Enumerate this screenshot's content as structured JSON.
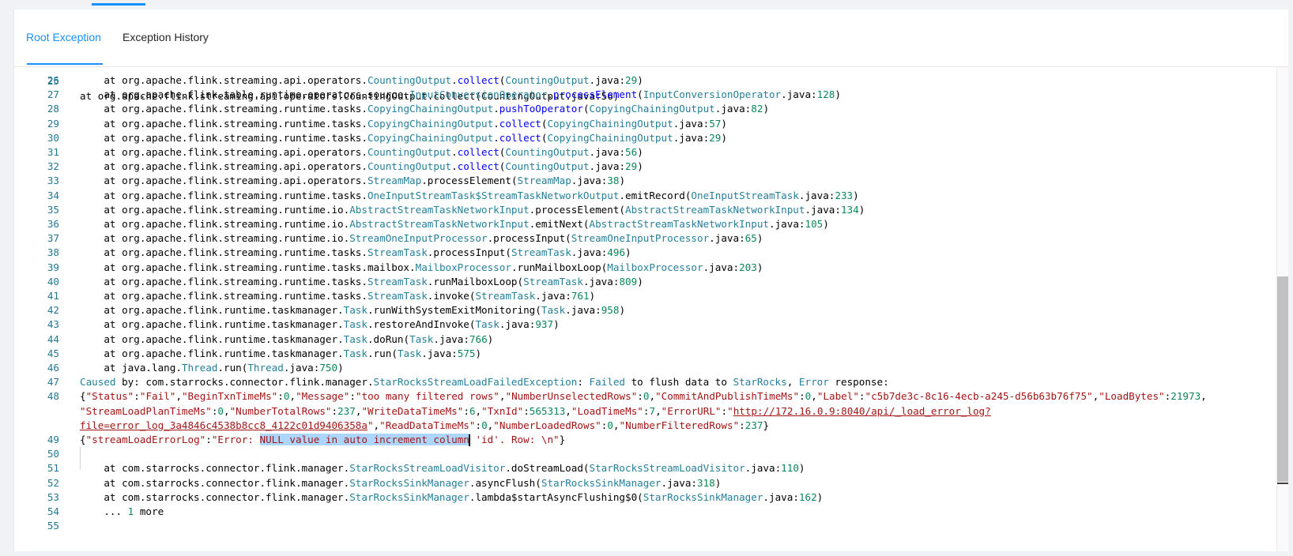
{
  "tabs": {
    "root_exception": "Root Exception",
    "exception_history": "Exception History"
  },
  "colors": {
    "accent": "#1890ff",
    "line_number": "#237893",
    "class_name": "#267f99",
    "method": "#0000ff",
    "number": "#098658",
    "string": "#a31515",
    "selection": "#add6ff"
  },
  "code": {
    "partial_top_line": "at org.apache.flink.streaming.api.operators.CountingOutput.collect(CountingOutput.java:56)",
    "lines": [
      {
        "n": "26",
        "pre": "    at org.apache.flink.streaming.api.operators.",
        "cls": "CountingOutput",
        "mid": ".",
        "meth": "collect",
        "lp": "(",
        "file": "CountingOutput",
        "ext": ".java:",
        "num": "29",
        "rp": ")"
      },
      {
        "n": "27",
        "pre": "    at org.apache.flink.table.runtime.operators.source.",
        "cls": "InputConversionOperator",
        "mid": ".",
        "meth": "processElement",
        "lp": "(",
        "file": "InputConversionOperator",
        "ext": ".java:",
        "num": "128",
        "rp": ")"
      },
      {
        "n": "28",
        "pre": "    at org.apache.flink.streaming.runtime.tasks.",
        "cls": "CopyingChainingOutput",
        "mid": ".",
        "meth": "pushToOperator",
        "lp": "(",
        "file": "CopyingChainingOutput",
        "ext": ".java:",
        "num": "82",
        "rp": ")"
      },
      {
        "n": "29",
        "pre": "    at org.apache.flink.streaming.runtime.tasks.",
        "cls": "CopyingChainingOutput",
        "mid": ".",
        "meth": "collect",
        "lp": "(",
        "file": "CopyingChainingOutput",
        "ext": ".java:",
        "num": "57",
        "rp": ")"
      },
      {
        "n": "30",
        "pre": "    at org.apache.flink.streaming.runtime.tasks.",
        "cls": "CopyingChainingOutput",
        "mid": ".",
        "meth": "collect",
        "lp": "(",
        "file": "CopyingChainingOutput",
        "ext": ".java:",
        "num": "29",
        "rp": ")"
      },
      {
        "n": "31",
        "pre": "    at org.apache.flink.streaming.api.operators.",
        "cls": "CountingOutput",
        "mid": ".",
        "meth": "collect",
        "lp": "(",
        "file": "CountingOutput",
        "ext": ".java:",
        "num": "56",
        "rp": ")"
      },
      {
        "n": "32",
        "pre": "    at org.apache.flink.streaming.api.operators.",
        "cls": "CountingOutput",
        "mid": ".",
        "meth": "collect",
        "lp": "(",
        "file": "CountingOutput",
        "ext": ".java:",
        "num": "29",
        "rp": ")"
      },
      {
        "n": "33",
        "pre": "    at org.apache.flink.streaming.api.operators.",
        "cls": "StreamMap",
        "mid": ".processElement",
        "meth": "",
        "lp": "(",
        "file": "StreamMap",
        "ext": ".java:",
        "num": "38",
        "rp": ")"
      },
      {
        "n": "34",
        "pre": "    at org.apache.flink.streaming.runtime.tasks.",
        "cls": "OneInputStreamTask$StreamTaskNetworkOutput",
        "mid": ".emitRecord",
        "meth": "",
        "lp": "(",
        "file": "OneInputStreamTask",
        "ext": ".java:",
        "num": "233",
        "rp": ")"
      },
      {
        "n": "35",
        "pre": "    at org.apache.flink.streaming.runtime.io.",
        "cls": "AbstractStreamTaskNetworkInput",
        "mid": ".processElement",
        "meth": "",
        "lp": "(",
        "file": "AbstractStreamTaskNetworkInput",
        "ext": ".java:",
        "num": "134",
        "rp": ")"
      },
      {
        "n": "36",
        "pre": "    at org.apache.flink.streaming.runtime.io.",
        "cls": "AbstractStreamTaskNetworkInput",
        "mid": ".emitNext",
        "meth": "",
        "lp": "(",
        "file": "AbstractStreamTaskNetworkInput",
        "ext": ".java:",
        "num": "105",
        "rp": ")"
      },
      {
        "n": "37",
        "pre": "    at org.apache.flink.streaming.runtime.io.",
        "cls": "StreamOneInputProcessor",
        "mid": ".processInput",
        "meth": "",
        "lp": "(",
        "file": "StreamOneInputProcessor",
        "ext": ".java:",
        "num": "65",
        "rp": ")"
      },
      {
        "n": "38",
        "pre": "    at org.apache.flink.streaming.runtime.tasks.",
        "cls": "StreamTask",
        "mid": ".processInput",
        "meth": "",
        "lp": "(",
        "file": "StreamTask",
        "ext": ".java:",
        "num": "496",
        "rp": ")"
      },
      {
        "n": "39",
        "pre": "    at org.apache.flink.streaming.runtime.tasks.mailbox.",
        "cls": "MailboxProcessor",
        "mid": ".runMailboxLoop",
        "meth": "",
        "lp": "(",
        "file": "MailboxProcessor",
        "ext": ".java:",
        "num": "203",
        "rp": ")"
      },
      {
        "n": "40",
        "pre": "    at org.apache.flink.streaming.runtime.tasks.",
        "cls": "StreamTask",
        "mid": ".runMailboxLoop",
        "meth": "",
        "lp": "(",
        "file": "StreamTask",
        "ext": ".java:",
        "num": "809",
        "rp": ")"
      },
      {
        "n": "41",
        "pre": "    at org.apache.flink.streaming.runtime.tasks.",
        "cls": "StreamTask",
        "mid": ".invoke",
        "meth": "",
        "lp": "(",
        "file": "StreamTask",
        "ext": ".java:",
        "num": "761",
        "rp": ")"
      },
      {
        "n": "42",
        "pre": "    at org.apache.flink.runtime.taskmanager.",
        "cls": "Task",
        "mid": ".runWithSystemExitMonitoring",
        "meth": "",
        "lp": "(",
        "file": "Task",
        "ext": ".java:",
        "num": "958",
        "rp": ")"
      },
      {
        "n": "43",
        "pre": "    at org.apache.flink.runtime.taskmanager.",
        "cls": "Task",
        "mid": ".restoreAndInvoke",
        "meth": "",
        "lp": "(",
        "file": "Task",
        "ext": ".java:",
        "num": "937",
        "rp": ")"
      },
      {
        "n": "44",
        "pre": "    at org.apache.flink.runtime.taskmanager.",
        "cls": "Task",
        "mid": ".doRun",
        "meth": "",
        "lp": "(",
        "file": "Task",
        "ext": ".java:",
        "num": "766",
        "rp": ")"
      },
      {
        "n": "45",
        "pre": "    at org.apache.flink.runtime.taskmanager.",
        "cls": "Task",
        "mid": ".run",
        "meth": "",
        "lp": "(",
        "file": "Task",
        "ext": ".java:",
        "num": "575",
        "rp": ")"
      },
      {
        "n": "46",
        "pre": "    at java.lang.",
        "cls": "Thread",
        "mid": ".run",
        "meth": "",
        "lp": "(",
        "file": "Thread",
        "ext": ".java:",
        "num": "750",
        "rp": ")"
      }
    ],
    "line47": {
      "n": "47",
      "caused": "Caused",
      "by": " by: com.starrocks.connector.flink.manager.",
      "cls": "StarRocksStreamLoadFailedException",
      "colon": ": ",
      "failed": "Failed",
      "to_flush": " to flush data to ",
      "starrocks": "StarRocks",
      "comma": ", ",
      "error": "Error",
      "response": " response:"
    },
    "line48": {
      "n": "48",
      "row1": [
        {
          "t": "{",
          "c": ""
        },
        {
          "t": "\"Status\"",
          "c": "s"
        },
        {
          "t": ":",
          "c": ""
        },
        {
          "t": "\"Fail\"",
          "c": "s"
        },
        {
          "t": ",",
          "c": ""
        },
        {
          "t": "\"BeginTxnTimeMs\"",
          "c": "s"
        },
        {
          "t": ":",
          "c": ""
        },
        {
          "t": "0",
          "c": "n"
        },
        {
          "t": ",",
          "c": ""
        },
        {
          "t": "\"Message\"",
          "c": "s"
        },
        {
          "t": ":",
          "c": ""
        },
        {
          "t": "\"too many filtered rows\"",
          "c": "s"
        },
        {
          "t": ",",
          "c": ""
        },
        {
          "t": "\"NumberUnselectedRows\"",
          "c": "s"
        },
        {
          "t": ":",
          "c": ""
        },
        {
          "t": "0",
          "c": "n"
        },
        {
          "t": ",",
          "c": ""
        },
        {
          "t": "\"CommitAndPublishTimeMs\"",
          "c": "s"
        },
        {
          "t": ":",
          "c": ""
        },
        {
          "t": "0",
          "c": "n"
        },
        {
          "t": ",",
          "c": ""
        },
        {
          "t": "\"Label\"",
          "c": "s"
        },
        {
          "t": ":",
          "c": ""
        },
        {
          "t": "\"c5b7de3c-8c16-4ecb-a245-d56b63b76f75\"",
          "c": "s"
        },
        {
          "t": ",",
          "c": ""
        },
        {
          "t": "\"LoadBytes\"",
          "c": "s"
        },
        {
          "t": ":",
          "c": ""
        },
        {
          "t": "21973",
          "c": "n"
        },
        {
          "t": ",",
          "c": ""
        }
      ],
      "row2": [
        {
          "t": "\"StreamLoadPlanTimeMs\"",
          "c": "s"
        },
        {
          "t": ":",
          "c": ""
        },
        {
          "t": "0",
          "c": "n"
        },
        {
          "t": ",",
          "c": ""
        },
        {
          "t": "\"NumberTotalRows\"",
          "c": "s"
        },
        {
          "t": ":",
          "c": ""
        },
        {
          "t": "237",
          "c": "n"
        },
        {
          "t": ",",
          "c": ""
        },
        {
          "t": "\"WriteDataTimeMs\"",
          "c": "s"
        },
        {
          "t": ":",
          "c": ""
        },
        {
          "t": "6",
          "c": "n"
        },
        {
          "t": ",",
          "c": ""
        },
        {
          "t": "\"TxnId\"",
          "c": "s"
        },
        {
          "t": ":",
          "c": ""
        },
        {
          "t": "565313",
          "c": "n"
        },
        {
          "t": ",",
          "c": ""
        },
        {
          "t": "\"LoadTimeMs\"",
          "c": "s"
        },
        {
          "t": ":",
          "c": ""
        },
        {
          "t": "7",
          "c": "n"
        },
        {
          "t": ",",
          "c": ""
        },
        {
          "t": "\"ErrorURL\"",
          "c": "s"
        },
        {
          "t": ":",
          "c": ""
        },
        {
          "t": "\"",
          "c": "s"
        },
        {
          "t": "http://172.16.0.9:8040/api/_load_error_log?",
          "c": "u"
        }
      ],
      "row3": [
        {
          "t": "file=error_log_3a4846c4538b8cc8_4122c01d9406358a",
          "c": "u"
        },
        {
          "t": "\"",
          "c": "s"
        },
        {
          "t": ",",
          "c": ""
        },
        {
          "t": "\"ReadDataTimeMs\"",
          "c": "s"
        },
        {
          "t": ":",
          "c": ""
        },
        {
          "t": "0",
          "c": "n"
        },
        {
          "t": ",",
          "c": ""
        },
        {
          "t": "\"NumberLoadedRows\"",
          "c": "s"
        },
        {
          "t": ":",
          "c": ""
        },
        {
          "t": "0",
          "c": "n"
        },
        {
          "t": ",",
          "c": ""
        },
        {
          "t": "\"NumberFilteredRows\"",
          "c": "s"
        },
        {
          "t": ":",
          "c": ""
        },
        {
          "t": "237",
          "c": "n"
        },
        {
          "t": "}",
          "c": ""
        }
      ]
    },
    "line49": {
      "n": "49",
      "open": "{",
      "key": "\"streamLoadErrorLog\"",
      "colon": ":",
      "pre": "\"Error: ",
      "selected": "NULL value in auto increment column",
      "post": " 'id'. Row: \\n\"",
      "close": "}"
    },
    "line50": {
      "n": "50"
    },
    "tail": [
      {
        "n": "51",
        "pre": "    at com.starrocks.connector.flink.manager.",
        "cls": "StarRocksStreamLoadVisitor",
        "mid": ".doStreamLoad",
        "lp": "(",
        "file": "StarRocksStreamLoadVisitor",
        "ext": ".java:",
        "num": "110",
        "rp": ")"
      },
      {
        "n": "52",
        "pre": "    at com.starrocks.connector.flink.manager.",
        "cls": "StarRocksSinkManager",
        "mid": ".asyncFlush",
        "lp": "(",
        "file": "StarRocksSinkManager",
        "ext": ".java:",
        "num": "318",
        "rp": ")"
      },
      {
        "n": "53",
        "pre": "    at com.starrocks.connector.flink.manager.",
        "cls": "StarRocksSinkManager",
        "mid": ".lambda$startAsyncFlushing$0",
        "lp": "(",
        "file": "StarRocksSinkManager",
        "ext": ".java:",
        "num": "162",
        "rp": ")"
      }
    ],
    "line54": {
      "n": "54",
      "pre": "    ... ",
      "num": "1",
      "post": " more"
    },
    "line55": {
      "n": "55"
    }
  }
}
